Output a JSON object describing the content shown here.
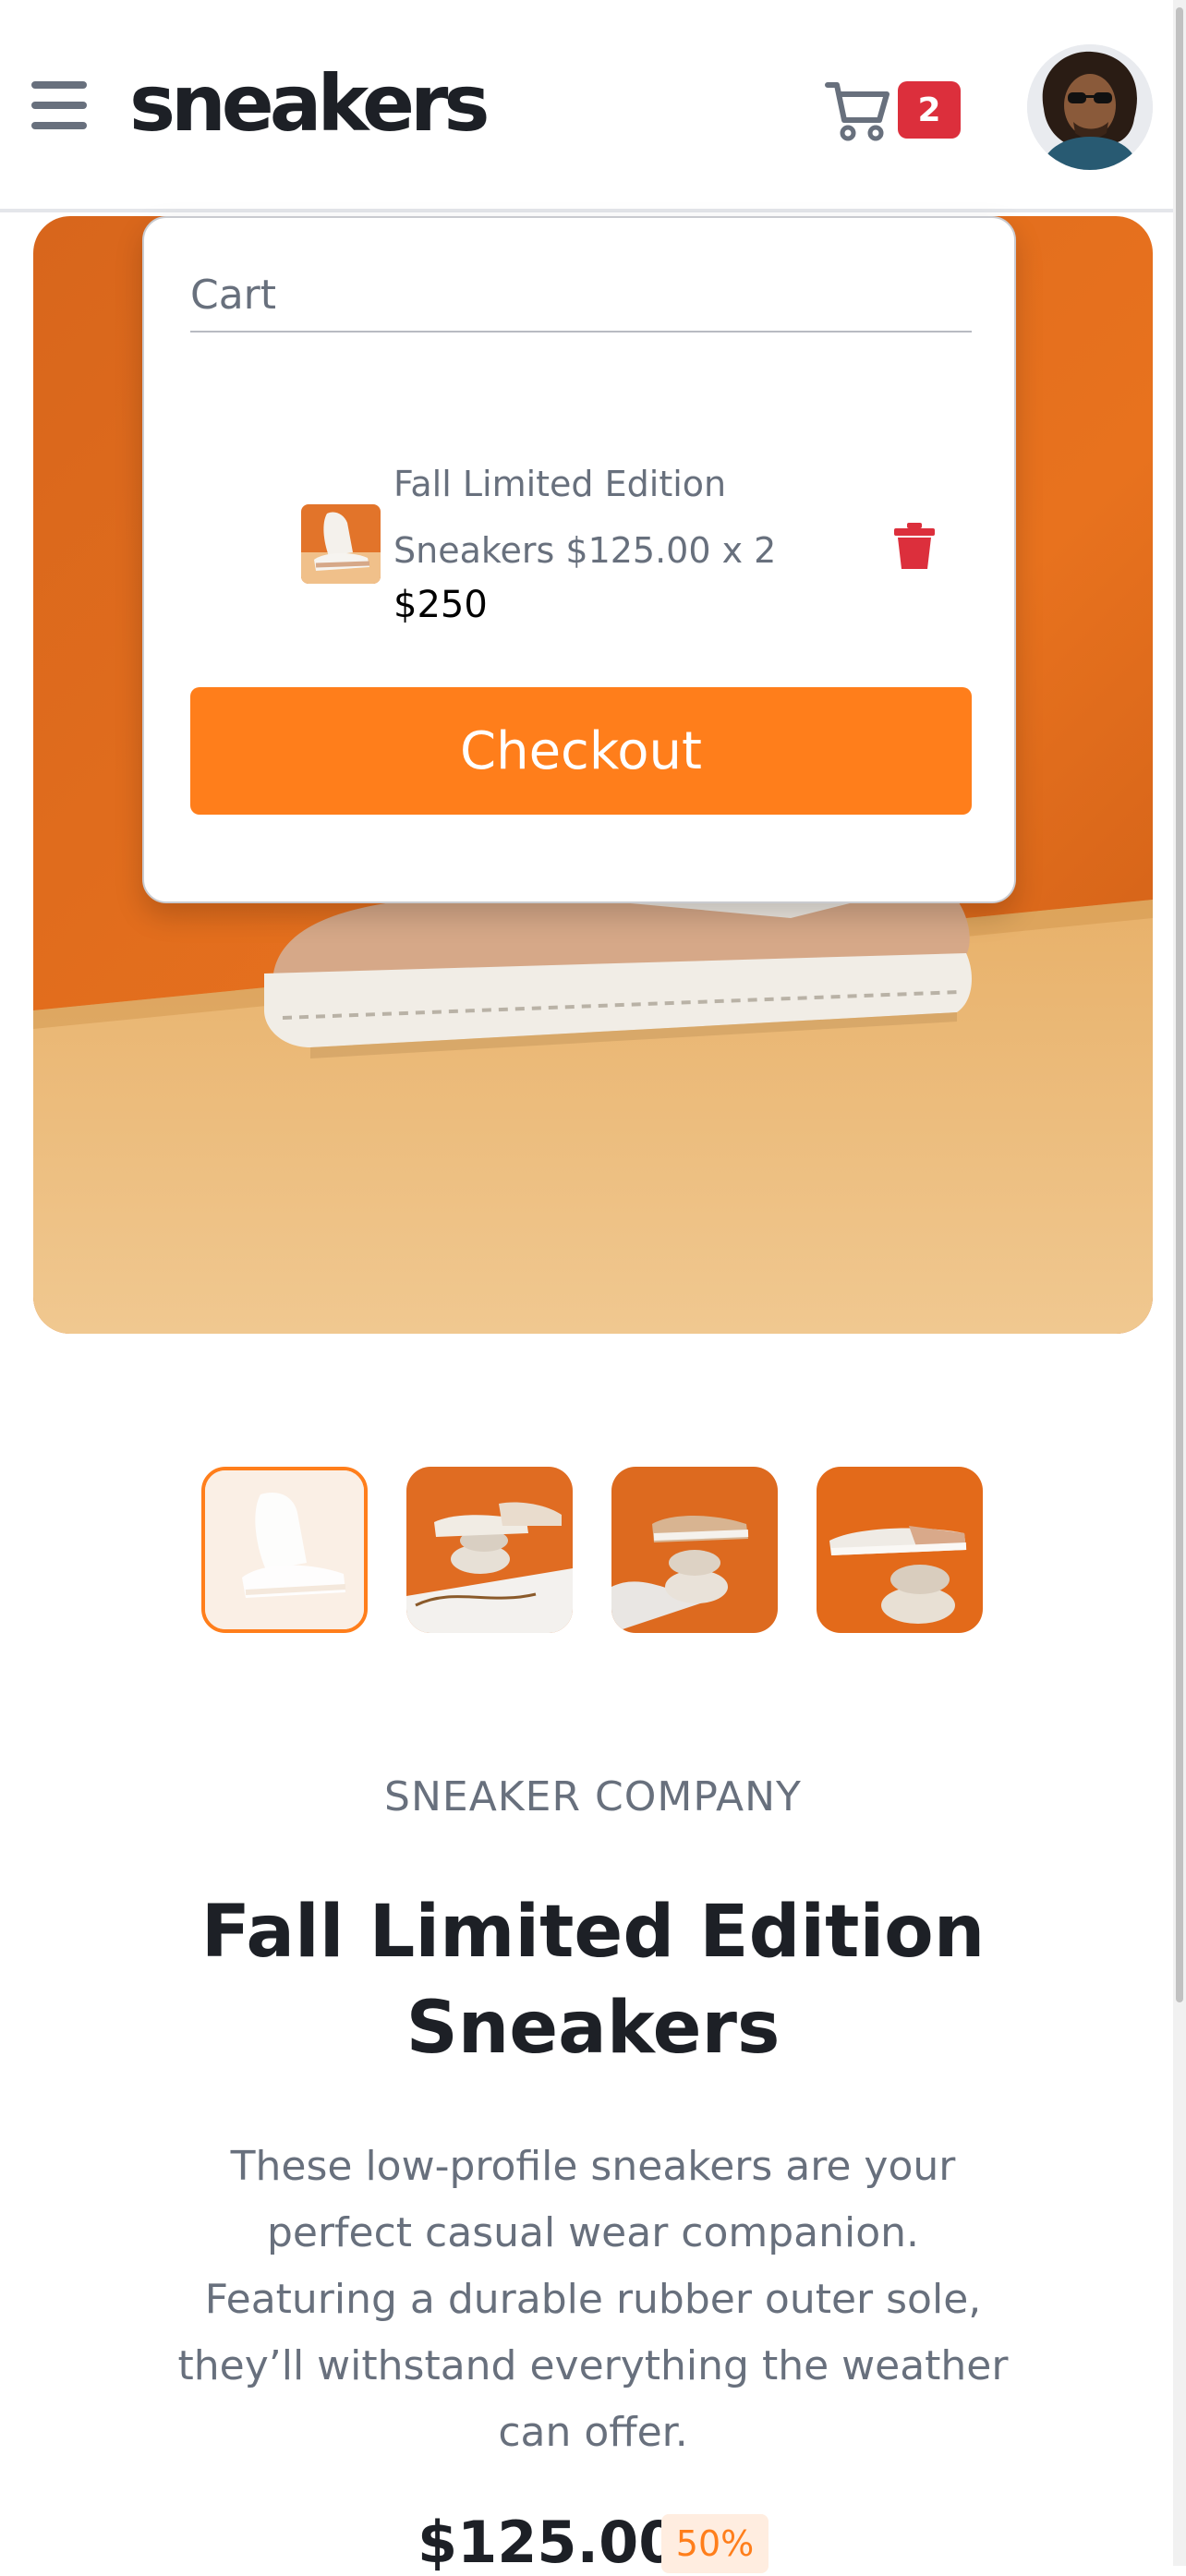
{
  "header": {
    "logo": "sneakers",
    "cart_count": "2"
  },
  "cart": {
    "title": "Cart",
    "item_desc": "Fall Limited Edition Sneakers $125.00 x 2",
    "item_total": "$250",
    "checkout_label": "Checkout"
  },
  "product": {
    "company": "SNEAKER COMPANY",
    "title": "Fall Limited Edition Sneakers",
    "description": "These low-profile sneakers are your perfect casual wear companion. Featuring a durable rubber outer sole, they’ll withstand everything the weather can offer.",
    "price": "$125.00",
    "discount": "50%"
  },
  "colors": {
    "accent": "#ff7e1b",
    "badge": "#dc2f3c",
    "text_dark": "#1d2026",
    "text_muted": "#68707d"
  }
}
